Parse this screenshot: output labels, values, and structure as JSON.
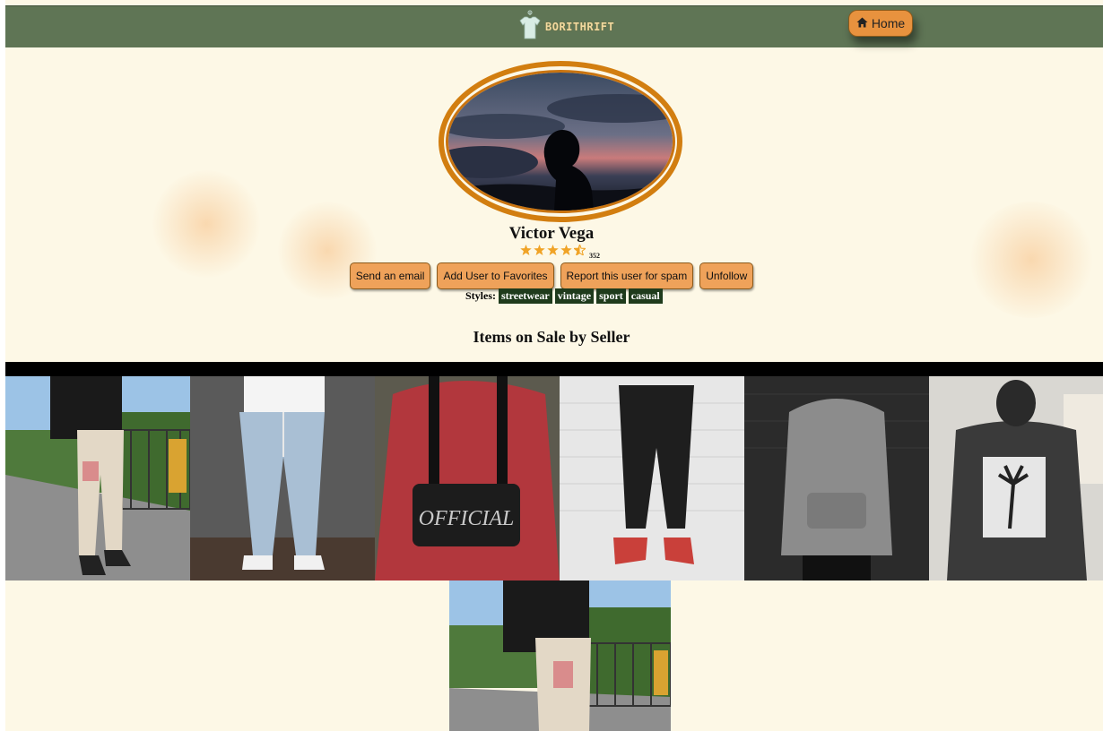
{
  "header": {
    "brand": "BORITHRIFT",
    "home_label": "Home",
    "logo_icon": "tshirt-icon",
    "home_icon": "home-icon"
  },
  "profile": {
    "name": "Victor Vega",
    "rating_stars": 4.5,
    "rating_count": "352",
    "actions": {
      "email": "Send an email",
      "favorite": "Add User to Favorites",
      "report": "Report this user for spam",
      "unfollow": "Unfollow"
    },
    "styles_label": "Styles:",
    "styles": [
      "streetwear",
      "vintage",
      "sport",
      "casual"
    ]
  },
  "items_section": {
    "title": "Items on Sale by Seller"
  },
  "colors": {
    "navbar": "#5f7555",
    "accent": "#e8923e",
    "background": "#fdf8e6",
    "tag": "#1f3b1c",
    "ring": "#d27e10"
  }
}
